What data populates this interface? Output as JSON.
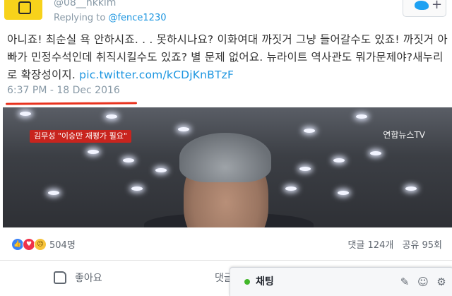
{
  "tweet": {
    "handle": "@08__hkkim",
    "reply_prefix": "Replying to",
    "reply_mention": "@fence1230",
    "text": "아니죠! 최순실 욕 안하시죠. . . 못하시나요? 이화여대 까짓거 그냥 들어갈수도 있죠! 까짓거 아빠가 민정수석인데 취직시킬수도 있죠? 별 문제 없어요. 뉴라이트 역사관도 뭐가문제야?새누리로 확장성이지.",
    "link": "pic.twitter.com/kCDjKnBTzF",
    "time": "6:37 PM - 18 Dec 2016",
    "follow_icon": "twitter-bird-icon",
    "follow_plus": "+"
  },
  "video": {
    "caption": "김무성 \"이승만 재평가 필요\"",
    "watermark": "연합뉴스TV"
  },
  "reactions": {
    "count": "504명",
    "icons": [
      "like-icon",
      "love-icon",
      "sad-icon"
    ],
    "comments": "댓글 124개",
    "shares": "공유 95회"
  },
  "actions": {
    "like_label": "좋아요",
    "comment_label": "댓글"
  },
  "chat": {
    "label": "채팅",
    "status_color": "#42b72a"
  },
  "colors": {
    "link": "#1b95e0",
    "muted": "#8899a6",
    "annotation": "#e8321e",
    "fb_like": "#3b82f6"
  }
}
